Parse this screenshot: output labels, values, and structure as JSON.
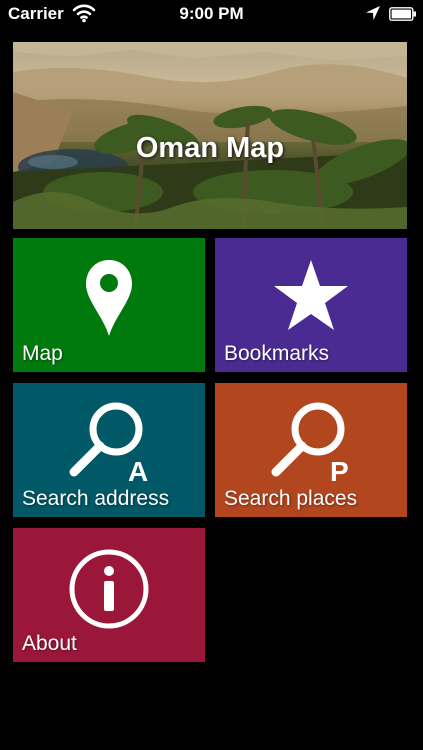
{
  "status_bar": {
    "carrier": "Carrier",
    "time": "9:00 PM"
  },
  "banner": {
    "title": "Oman Map"
  },
  "tiles": [
    {
      "label": "Map",
      "color": "#007a0d",
      "icon": "map-pin-icon"
    },
    {
      "label": "Bookmarks",
      "color": "#4a2b91",
      "icon": "star-icon"
    },
    {
      "label": "Search address",
      "color": "#015866",
      "icon": "search-address-icon",
      "icon_letter": "A"
    },
    {
      "label": "Search places",
      "color": "#b1461f",
      "icon": "search-places-icon",
      "icon_letter": "P"
    },
    {
      "label": "About",
      "color": "#9a1739",
      "icon": "info-icon"
    }
  ]
}
